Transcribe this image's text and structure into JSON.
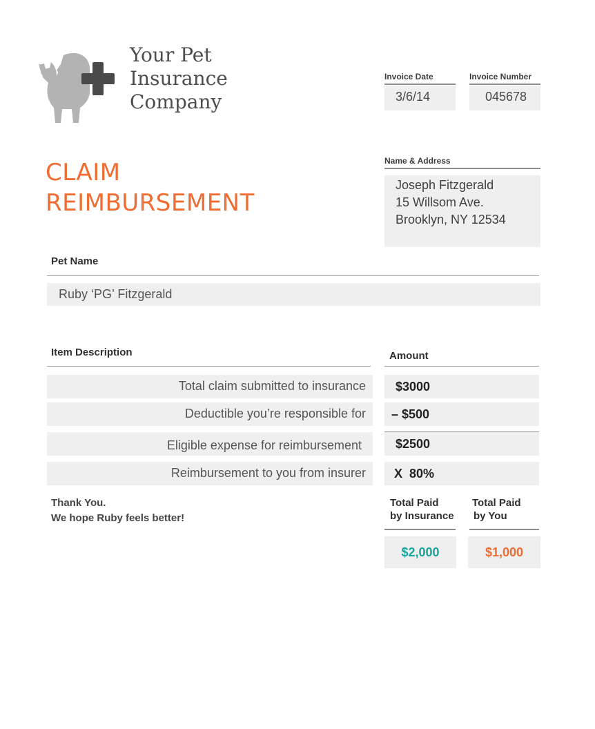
{
  "company": {
    "name_lines": [
      "Your Pet",
      "Insurance",
      "Company"
    ],
    "logo_icon": "cat-with-medical-cross-icon"
  },
  "invoice": {
    "date_label": "Invoice Date",
    "date_value": "3/6/14",
    "number_label": "Invoice Number",
    "number_value": "045678"
  },
  "title": {
    "line1": "CLAIM",
    "line2": "REIMBURSEMENT"
  },
  "address": {
    "label": "Name & Address",
    "lines": [
      "Joseph Fitzgerald",
      "15 Willsom Ave.",
      "Brooklyn, NY 12534"
    ]
  },
  "pet": {
    "label": "Pet Name",
    "value": "Ruby ‘PG’ Fitzgerald"
  },
  "items": {
    "description_header": "Item Description",
    "amount_header": "Amount",
    "rows": [
      {
        "description": "Total claim submitted to insurance",
        "amount": "$3000"
      },
      {
        "description": "Deductible you’re responsible for",
        "amount": "– $500"
      },
      {
        "description": "Eligible expense for reimbursement",
        "amount": "$2500"
      },
      {
        "description": "Reimbursement to you from insurer",
        "amount": "X  80%"
      }
    ]
  },
  "thanks": {
    "line1": "Thank You.",
    "line2": "We hope Ruby feels better!"
  },
  "totals": {
    "insurance_label_line1": "Total Paid",
    "insurance_label_line2": "by Insurance",
    "insurance_value": "$2,000",
    "you_label_line1": "Total Paid",
    "you_label_line2": "by You",
    "you_value": "$1,000"
  },
  "colors": {
    "accent_orange": "#ef6c33",
    "accent_teal": "#1aa39a",
    "logo_gray": "#b3b3b3",
    "cross_dark": "#4a4a4a",
    "box_fill": "#efefef"
  }
}
